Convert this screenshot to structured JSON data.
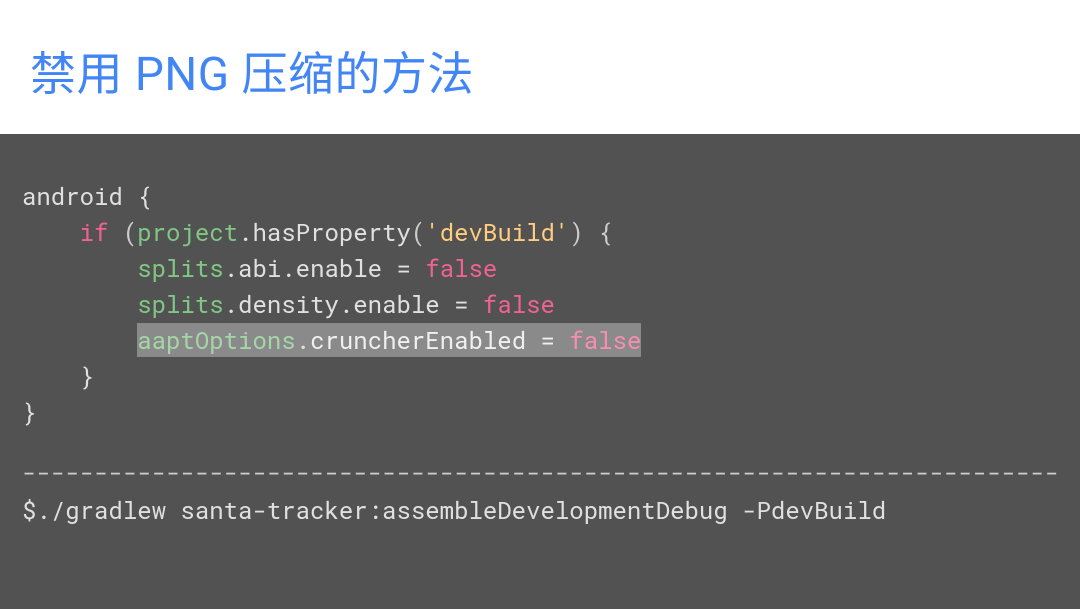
{
  "slide": {
    "title": "禁用 PNG 压缩的方法"
  },
  "code": {
    "line1": "android {",
    "line2_indent": "    ",
    "line2_if": "if",
    "line2_paren1": " (",
    "line2_project": "project",
    "line2_dot1": ".",
    "line2_method": "hasProperty",
    "line2_paren2": "(",
    "line2_str": "'devBuild'",
    "line2_paren3": ") {",
    "line3_indent": "        ",
    "line3_splits": "splits",
    "line3_dot1": ".",
    "line3_abi": "abi",
    "line3_dot2": ".",
    "line3_enable": "enable",
    "line3_eq": " = ",
    "line3_false": "false",
    "line4_indent": "        ",
    "line4_splits": "splits",
    "line4_dot1": ".",
    "line4_density": "density",
    "line4_dot2": ".",
    "line4_enable": "enable",
    "line4_eq": " = ",
    "line4_false": "false",
    "line5_indent": "        ",
    "line5_aapt": "aaptOptions",
    "line5_dot": ".",
    "line5_cruncher": "cruncherEnabled",
    "line5_eq": " = ",
    "line5_false": "false",
    "line6": "    }",
    "line7": "}",
    "divider": "-------------------------------------------------------------------------",
    "command": "$./gradlew santa-tracker:assembleDevelopmentDebug -PdevBuild"
  }
}
